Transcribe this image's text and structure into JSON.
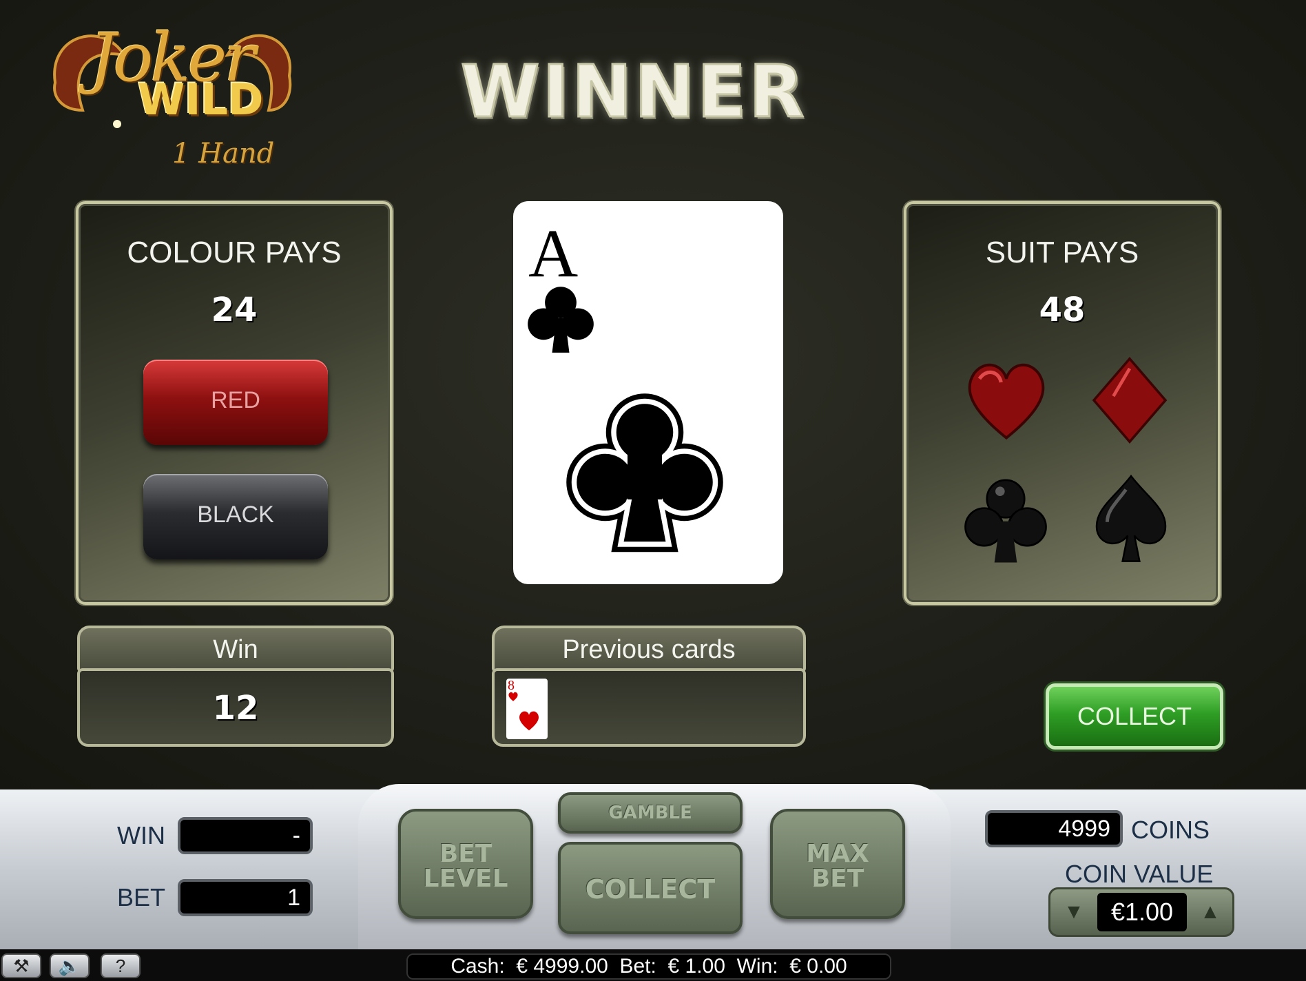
{
  "logo": {
    "line1": "Joker",
    "line2": "WILD",
    "line3": "1 Hand"
  },
  "banner": "WINNER",
  "colour_panel": {
    "title": "COLOUR PAYS",
    "value": "24",
    "red_label": "RED",
    "black_label": "BLACK"
  },
  "suit_panel": {
    "title": "SUIT PAYS",
    "value": "48",
    "suits": [
      "hearts",
      "diamonds",
      "clubs",
      "spades"
    ]
  },
  "current_card": {
    "rank": "A",
    "suit": "clubs"
  },
  "win_box": {
    "label": "Win",
    "value": "12"
  },
  "previous_cards": {
    "label": "Previous cards",
    "cards": [
      {
        "rank": "8",
        "suit": "hearts"
      }
    ]
  },
  "collect_button": "COLLECT",
  "controls": {
    "win_label": "WIN",
    "win_value": "-",
    "bet_label": "BET",
    "bet_value": "1",
    "bet_level": "BET LEVEL",
    "gamble": "GAMBLE",
    "collect": "COLLECT",
    "max_bet": "MAX BET",
    "coins_value": "4999",
    "coins_label": "COINS",
    "coin_value_label": "COIN VALUE",
    "coin_value": "€1.00"
  },
  "status_bar": {
    "text": "Cash:  € 4999.00  Bet:  € 1.00  Win:  € 0.00"
  },
  "icons": {
    "settings": "wrench-icon",
    "sound": "speaker-icon",
    "help": "question-icon"
  },
  "colors": {
    "red": "#8e1010",
    "green": "#2f9e25",
    "panel_border": "#c8c9a3"
  }
}
